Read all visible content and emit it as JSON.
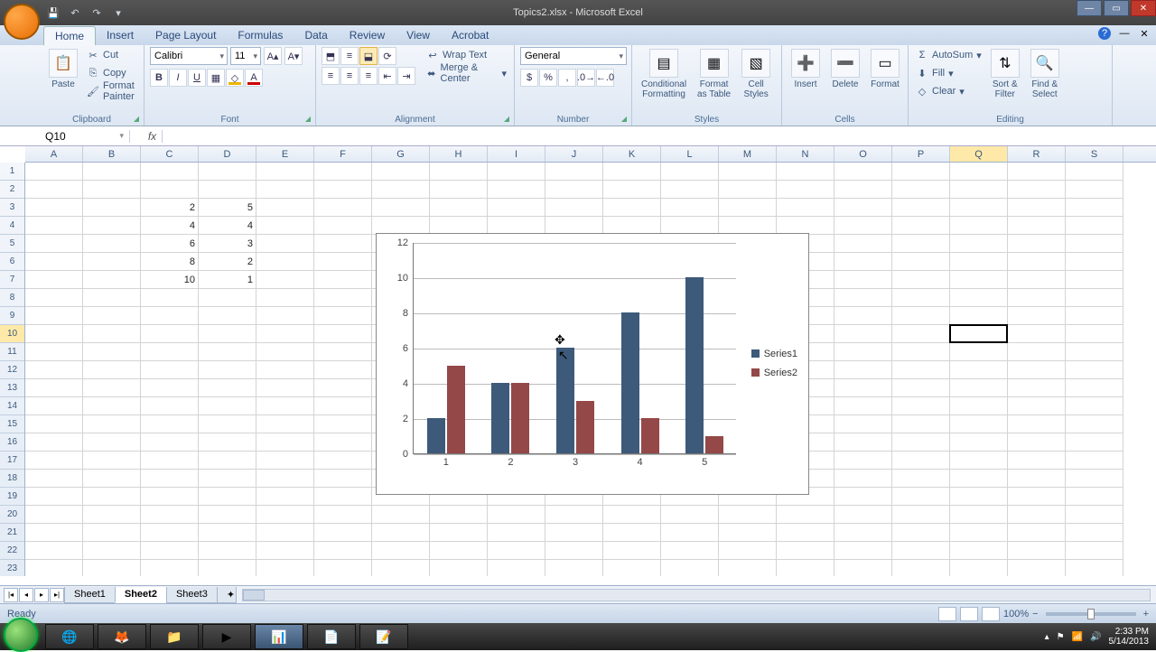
{
  "title": "Topics2.xlsx - Microsoft Excel",
  "tabs": [
    "Home",
    "Insert",
    "Page Layout",
    "Formulas",
    "Data",
    "Review",
    "View",
    "Acrobat"
  ],
  "active_tab": 0,
  "clipboard": {
    "paste": "Paste",
    "cut": "Cut",
    "copy": "Copy",
    "fmt": "Format Painter",
    "title": "Clipboard"
  },
  "font": {
    "name": "Calibri",
    "size": "11",
    "title": "Font"
  },
  "alignment": {
    "wrap": "Wrap Text",
    "merge": "Merge & Center",
    "title": "Alignment"
  },
  "number": {
    "format": "General",
    "title": "Number"
  },
  "styles": {
    "cond": "Conditional\nFormatting",
    "fas": "Format\nas Table",
    "cell": "Cell\nStyles",
    "title": "Styles"
  },
  "cells_grp": {
    "insert": "Insert",
    "delete": "Delete",
    "format": "Format",
    "title": "Cells"
  },
  "editing": {
    "autosum": "AutoSum",
    "fill": "Fill",
    "clear": "Clear",
    "sort": "Sort &\nFilter",
    "find": "Find &\nSelect",
    "title": "Editing"
  },
  "namebox": "Q10",
  "formula": "",
  "columns": [
    "A",
    "B",
    "C",
    "D",
    "E",
    "F",
    "G",
    "H",
    "I",
    "J",
    "K",
    "L",
    "M",
    "N",
    "O",
    "P",
    "Q",
    "R",
    "S"
  ],
  "rows": 23,
  "active_col": "Q",
  "active_row": 10,
  "cell_data": {
    "C3": "2",
    "D3": "5",
    "C4": "4",
    "D4": "4",
    "C5": "6",
    "D5": "3",
    "C6": "8",
    "D6": "2",
    "C7": "10",
    "D7": "1"
  },
  "chart_data": {
    "type": "bar",
    "categories": [
      "1",
      "2",
      "3",
      "4",
      "5"
    ],
    "series": [
      {
        "name": "Series1",
        "values": [
          2,
          4,
          6,
          8,
          10
        ],
        "color": "#3d5a7a"
      },
      {
        "name": "Series2",
        "values": [
          5,
          4,
          3,
          2,
          1
        ],
        "color": "#944848"
      }
    ],
    "ylim": [
      0,
      12
    ],
    "yticks": [
      0,
      2,
      4,
      6,
      8,
      10,
      12
    ],
    "title": "",
    "xlabel": "",
    "ylabel": ""
  },
  "sheets": [
    "Sheet1",
    "Sheet2",
    "Sheet3"
  ],
  "active_sheet": 1,
  "status": "Ready",
  "zoom": "100%",
  "clock": {
    "time": "2:33 PM",
    "date": "5/14/2013"
  }
}
